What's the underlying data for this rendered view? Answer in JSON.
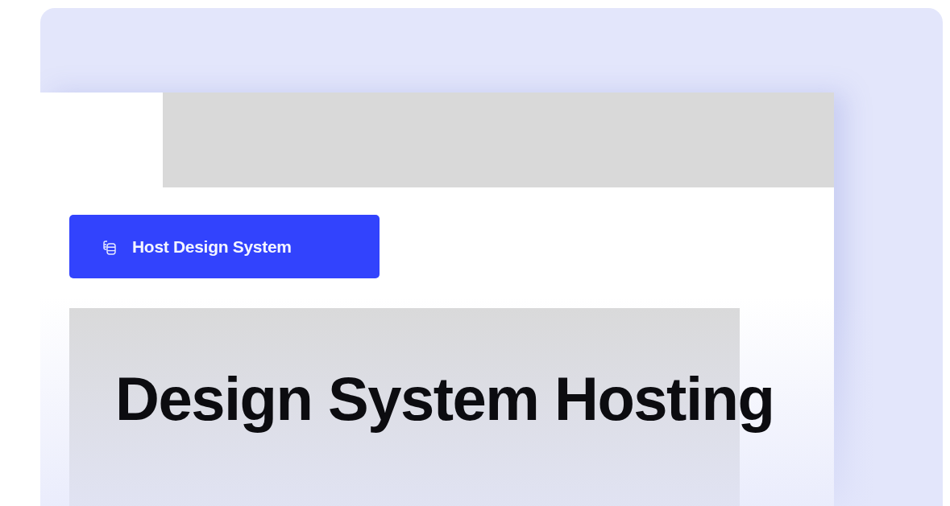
{
  "button": {
    "label": "Host Design System"
  },
  "heading": "Design System Hosting"
}
